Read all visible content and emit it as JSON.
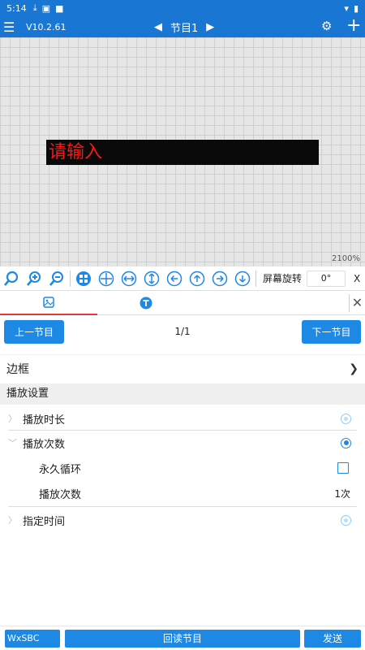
{
  "status": {
    "time": "5:14"
  },
  "appbar": {
    "version": "V10.2.61",
    "program": "节目1"
  },
  "canvas": {
    "led_text": "请输入",
    "zoom": "2100%"
  },
  "toolbar": {
    "rotate_label": "屏幕旋转",
    "rotate_value": "0°",
    "x_label": "X"
  },
  "pager": {
    "prev": "上一节目",
    "page": "1/1",
    "next": "下一节目"
  },
  "border": {
    "label": "边框"
  },
  "play": {
    "section": "播放设置",
    "duration": "播放时长",
    "times": "播放次数",
    "loop": "永久循环",
    "count_label": "播放次数",
    "count_value": "1次",
    "schedule": "指定时间"
  },
  "footer": {
    "device": "WxSBC",
    "read": "回读节目",
    "send": "发送"
  },
  "colors": {
    "primary": "#1976d2",
    "led_bg": "#0a0a0a",
    "led_text": "#ff1414",
    "tab_indicator": "#e53935"
  }
}
